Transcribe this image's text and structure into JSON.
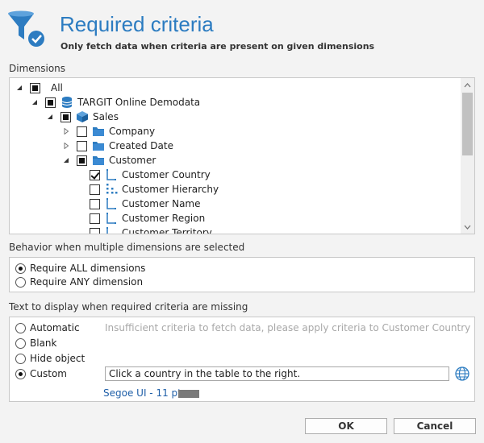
{
  "header": {
    "title": "Required criteria",
    "subtitle": "Only fetch data when criteria are present on given dimensions",
    "icon": "filter-check-icon"
  },
  "dimensions": {
    "label": "Dimensions",
    "tree": [
      {
        "label": "All",
        "state": "partial",
        "expander": "expanded",
        "icon": ""
      },
      {
        "label": "TARGIT Online Demodata",
        "state": "partial",
        "expander": "expanded",
        "icon": "database-icon"
      },
      {
        "label": "Sales",
        "state": "partial",
        "expander": "expanded",
        "icon": "cube-icon"
      },
      {
        "label": "Company",
        "state": "unchecked",
        "expander": "collapsed",
        "icon": "folder-icon"
      },
      {
        "label": "Created Date",
        "state": "unchecked",
        "expander": "collapsed",
        "icon": "folder-icon"
      },
      {
        "label": "Customer",
        "state": "partial",
        "expander": "expanded",
        "icon": "folder-icon"
      },
      {
        "label": "Customer Country",
        "state": "checked",
        "expander": "none",
        "icon": "level-icon"
      },
      {
        "label": "Customer Hierarchy",
        "state": "unchecked",
        "expander": "none",
        "icon": "hierarchy-icon"
      },
      {
        "label": "Customer Name",
        "state": "unchecked",
        "expander": "none",
        "icon": "level-icon"
      },
      {
        "label": "Customer Region",
        "state": "unchecked",
        "expander": "none",
        "icon": "level-icon"
      },
      {
        "label": "Customer Territory",
        "state": "unchecked",
        "expander": "none",
        "icon": "level-icon"
      }
    ]
  },
  "behavior": {
    "label": "Behavior when multiple dimensions are selected",
    "options": [
      {
        "label": "Require ALL dimensions",
        "selected": true
      },
      {
        "label": "Require ANY dimension",
        "selected": false
      }
    ]
  },
  "missing_text": {
    "label": "Text to display when required criteria are missing",
    "options": [
      {
        "label": "Automatic",
        "selected": false
      },
      {
        "label": "Blank",
        "selected": false
      },
      {
        "label": "Hide object",
        "selected": false
      },
      {
        "label": "Custom",
        "selected": true
      }
    ],
    "automatic_hint": "Insufficient criteria to fetch data, please apply criteria to Customer Country",
    "custom_value": "Click a country in the table to the right.",
    "font_label": "Segoe UI - 11 pt",
    "font_color": "#7a7a7a",
    "globe_icon": "globe-icon"
  },
  "buttons": {
    "ok": "OK",
    "cancel": "Cancel"
  },
  "colors": {
    "accent": "#2c7cc1",
    "folder": "#2d7cc1",
    "background": "#f3f3f3"
  }
}
